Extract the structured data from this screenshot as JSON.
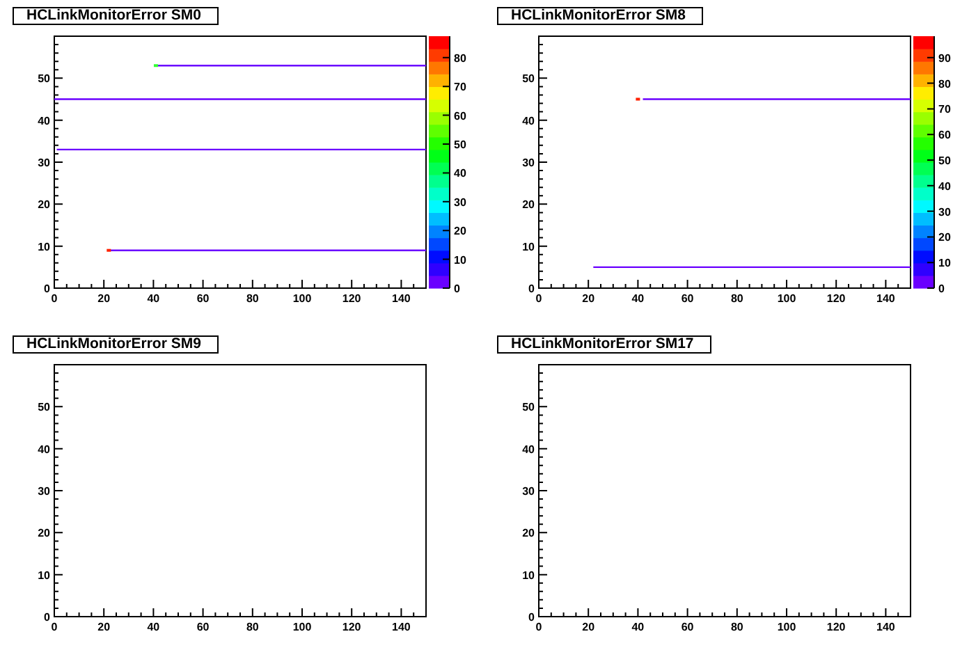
{
  "panels": [
    {
      "title": "HCLinkMonitorError SM0",
      "chart_data": {
        "type": "line",
        "xlim": [
          0,
          150
        ],
        "ylim": [
          0,
          60
        ],
        "xticks": [
          0,
          20,
          40,
          60,
          80,
          100,
          120,
          140
        ],
        "yticks": [
          0,
          10,
          20,
          30,
          40,
          50
        ],
        "x": [
          0,
          1,
          22,
          41,
          150
        ],
        "series": [
          {
            "color": "#6a00ff",
            "values": [
              null,
              null,
              null,
              53,
              53
            ]
          },
          {
            "color": "#6a00ff",
            "values": [
              45,
              45,
              45,
              45,
              45
            ]
          },
          {
            "color": "#6a00ff",
            "values": [
              null,
              33,
              33,
              33,
              33
            ]
          },
          {
            "color": "#6a00ff",
            "values": [
              null,
              null,
              9,
              9,
              9
            ]
          },
          {
            "color": "#33ff33",
            "marker": "square",
            "values": [
              null,
              null,
              null,
              53,
              null
            ]
          },
          {
            "color": "#ff2200",
            "marker": "square",
            "values": [
              null,
              null,
              9,
              null,
              null
            ]
          }
        ]
      },
      "color_scale": {
        "ticks": [
          "80",
          "70",
          "60",
          "50",
          "40",
          "30",
          "20",
          "10",
          "0"
        ]
      }
    },
    {
      "title": "HCLinkMonitorError SM8",
      "chart_data": {
        "type": "line",
        "xlim": [
          0,
          150
        ],
        "ylim": [
          0,
          60
        ],
        "xticks": [
          0,
          20,
          40,
          60,
          80,
          100,
          120,
          140
        ],
        "yticks": [
          0,
          10,
          20,
          30,
          40,
          50
        ],
        "x": [
          22,
          40,
          42,
          150
        ],
        "series": [
          {
            "color": "#6a00ff",
            "values": [
              null,
              null,
              45,
              45
            ]
          },
          {
            "color": "#6a00ff",
            "values": [
              5,
              5,
              5,
              5
            ]
          },
          {
            "color": "#ff2200",
            "marker": "square",
            "values": [
              null,
              45,
              null,
              null
            ]
          }
        ]
      },
      "color_scale": {
        "ticks": [
          "90",
          "80",
          "70",
          "60",
          "50",
          "40",
          "30",
          "20",
          "10",
          "0"
        ]
      }
    },
    {
      "title": "HCLinkMonitorError SM9",
      "chart_data": {
        "type": "line",
        "xlim": [
          0,
          150
        ],
        "ylim": [
          0,
          60
        ],
        "xticks": [
          0,
          20,
          40,
          60,
          80,
          100,
          120,
          140
        ],
        "yticks": [
          0,
          10,
          20,
          30,
          40,
          50
        ]
      }
    },
    {
      "title": "HCLinkMonitorError SM17",
      "chart_data": {
        "type": "line",
        "xlim": [
          0,
          150
        ],
        "ylim": [
          0,
          60
        ],
        "xticks": [
          0,
          20,
          40,
          60,
          80,
          100,
          120,
          140
        ],
        "yticks": [
          0,
          10,
          20,
          30,
          40,
          50
        ]
      }
    }
  ]
}
